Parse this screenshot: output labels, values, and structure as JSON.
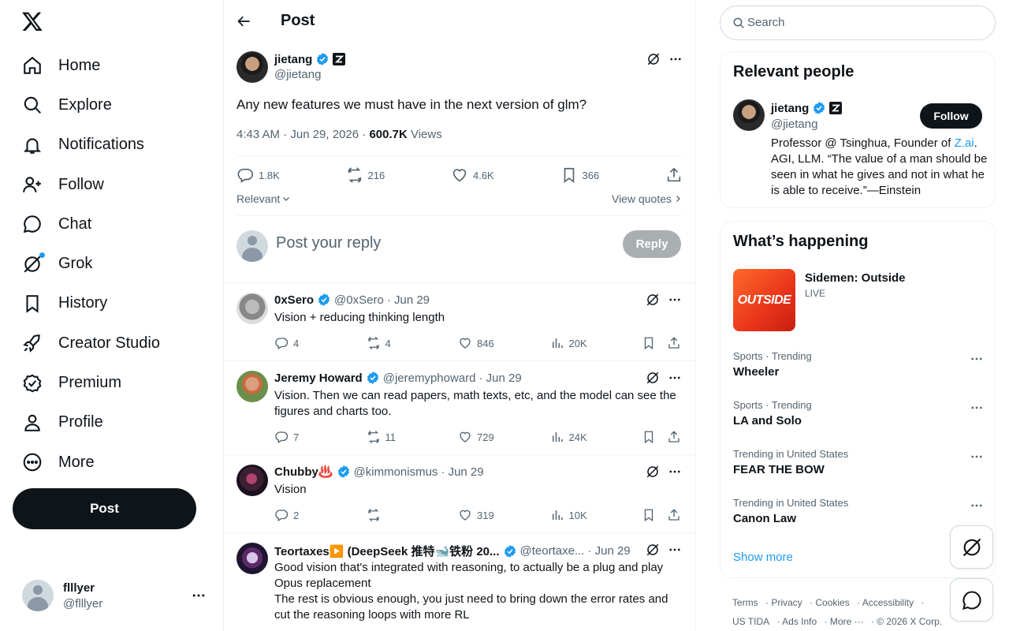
{
  "nav": {
    "items": [
      {
        "label": "Home",
        "icon": "home-icon"
      },
      {
        "label": "Explore",
        "icon": "search-icon"
      },
      {
        "label": "Notifications",
        "icon": "bell-icon"
      },
      {
        "label": "Follow",
        "icon": "add-person-icon"
      },
      {
        "label": "Chat",
        "icon": "chat-icon"
      },
      {
        "label": "Grok",
        "icon": "grok-icon"
      },
      {
        "label": "History",
        "icon": "bookmark-icon"
      },
      {
        "label": "Creator Studio",
        "icon": "rocket-icon"
      },
      {
        "label": "Premium",
        "icon": "verified-icon"
      },
      {
        "label": "Profile",
        "icon": "person-icon"
      },
      {
        "label": "More",
        "icon": "more-circle-icon"
      }
    ],
    "post_button": "Post"
  },
  "account": {
    "name": "flllyer",
    "handle": "@flllyer"
  },
  "header": {
    "title": "Post"
  },
  "post": {
    "author": "jietang",
    "handle": "@jietang",
    "text": "Any new features we must have in the next version of glm?",
    "time": "4:43 AM · Jun 29, 2026 · ",
    "views": "600.7K",
    "views_label": " Views",
    "replies": "1.8K",
    "reposts": "216",
    "likes": "4.6K",
    "bookmarks": "366",
    "sort": "Relevant",
    "view_quotes": "View quotes"
  },
  "composer": {
    "placeholder": "Post your reply",
    "button": "Reply"
  },
  "replies": [
    {
      "name": "0xSero",
      "handle": "@0xSero",
      "date": "· Jun 29",
      "text": [
        "Vision + reducing thinking length"
      ],
      "replies": "4",
      "reposts": "4",
      "likes": "846",
      "views": "20K"
    },
    {
      "name": "Jeremy Howard",
      "handle": "@jeremyphoward",
      "date": "· Jun 29",
      "text": [
        "Vision. Then we can read papers, math texts, etc, and the model can see the figures and charts too."
      ],
      "replies": "7",
      "reposts": "11",
      "likes": "729",
      "views": "24K"
    },
    {
      "name": "Chubby♨️",
      "handle": "@kimmonismus",
      "date": "· Jun 29",
      "text": [
        "Vision"
      ],
      "replies": "2",
      "reposts": "",
      "likes": "319",
      "views": "10K"
    },
    {
      "name": "Teortaxes▶️ (DeepSeek 推特🐋铁粉 20...",
      "handle": "@teortaxe...",
      "date": "· Jun 29",
      "text": [
        "Good vision that's integrated with reasoning, to actually be a plug and play Opus replacement",
        "The rest is obvious enough, you just need to bring down the error rates and cut the reasoning loops with more RL"
      ],
      "replies": "",
      "reposts": "",
      "likes": "",
      "views": ""
    }
  ],
  "search": {
    "placeholder": "Search"
  },
  "relevant": {
    "title": "Relevant people",
    "name": "jietang",
    "handle": "@jietang",
    "follow": "Follow",
    "bio_pre": "Professor @ Tsinghua, Founder of ",
    "bio_link": "Z.ai",
    "bio_post": ". AGI, LLM. “The value of a man should be seen in what he gives and not in what he is able to receive.”—Einstein"
  },
  "happening": {
    "title": "What’s happening",
    "featured_title": "Sidemen: Outside",
    "featured_status": "LIVE",
    "featured_image_text": "OUTSIDE",
    "trends": [
      {
        "context": "Sports · Trending",
        "title": "Wheeler"
      },
      {
        "context": "Sports · Trending",
        "title": "LA and Solo"
      },
      {
        "context": "Trending in United States",
        "title": "FEAR THE BOW"
      },
      {
        "context": "Trending in United States",
        "title": "Canon Law"
      }
    ],
    "show_more": "Show more"
  },
  "footer": {
    "row1": [
      "Terms",
      "Privacy",
      "Cookies",
      "Accessibility"
    ],
    "row2": [
      "US TIDA",
      "Ads Info",
      "More ···",
      "© 2026 X Corp."
    ]
  },
  "colors": {
    "accent": "#1d9bf0",
    "text": "#0f1419",
    "muted": "#536471"
  }
}
